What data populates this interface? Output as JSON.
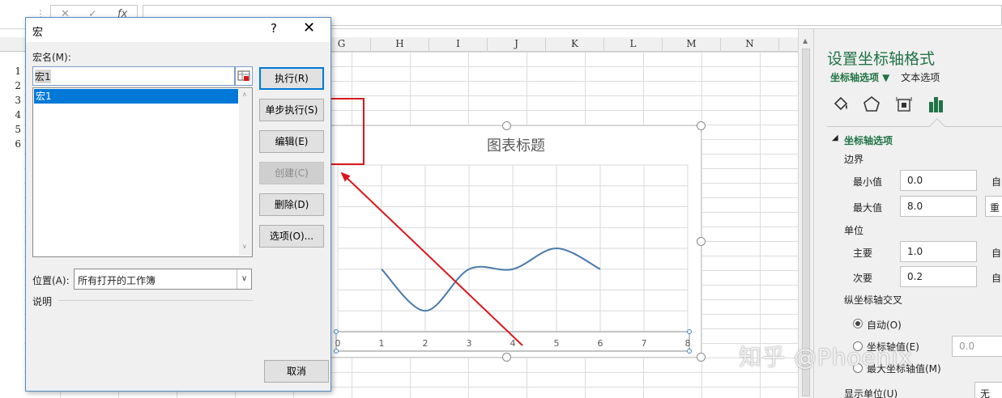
{
  "formula_bar": {
    "cancel_glyph": "✕",
    "confirm_glyph": "✓",
    "fx_glyph": "fx",
    "input_value": ""
  },
  "sheet": {
    "columns": [
      "G",
      "H",
      "I",
      "J",
      "K",
      "L",
      "M",
      "N"
    ],
    "rows": [
      "1",
      "2",
      "3",
      "4",
      "5",
      "6"
    ]
  },
  "chart": {
    "title": "图表标题"
  },
  "chart_data": {
    "type": "line",
    "title": "图表标题",
    "x_ticks": [
      "0",
      "1",
      "2",
      "3",
      "4",
      "5",
      "6",
      "7",
      "8"
    ],
    "xlim": [
      0,
      8
    ],
    "series": [
      {
        "x": [
          1,
          2,
          3,
          4,
          5,
          6
        ],
        "values": [
          3.0,
          1.0,
          3.0,
          3.0,
          4.0,
          3.0
        ]
      }
    ],
    "ylim": [
      0,
      8
    ],
    "grid": true,
    "line_color": "#4a7aab"
  },
  "dialog": {
    "title": "宏",
    "help": "?",
    "close": "✕",
    "macro_name_label": "宏名(M):",
    "macro_name_value": "宏1",
    "macro_list": [
      "宏1"
    ],
    "buttons": {
      "run": "执行(R)",
      "step": "单步执行(S)",
      "edit": "编辑(E)",
      "create": "创建(C)",
      "delete": "删除(D)",
      "options": "选项(O)...",
      "cancel": "取消"
    },
    "location_label": "位置(A):",
    "location_value": "所有打开的工作簿",
    "description_label": "说明"
  },
  "pane": {
    "title": "设置坐标轴格式",
    "tab_axis": "坐标轴选项 ▼",
    "tab_text": "文本选项",
    "section_title": "坐标轴选项",
    "bounds_label": "边界",
    "min_label": "最小值",
    "min_value": "0.0",
    "min_suffix": "自",
    "max_label": "最大值",
    "max_value": "8.0",
    "max_suffix": "重",
    "units_label": "单位",
    "major_label": "主要",
    "major_value": "1.0",
    "major_suffix": "自",
    "minor_label": "次要",
    "minor_value": "0.2",
    "minor_suffix": "自",
    "cross_label": "纵坐标轴交叉",
    "radio_auto": "自动(O)",
    "radio_axis_value": "坐标轴值(E)",
    "axis_value_input": "0.0",
    "radio_max": "最大坐标轴值(M)",
    "display_units_label": "显示单位(U)",
    "display_units_value": "无"
  },
  "watermark": "知乎 @Phoenix"
}
